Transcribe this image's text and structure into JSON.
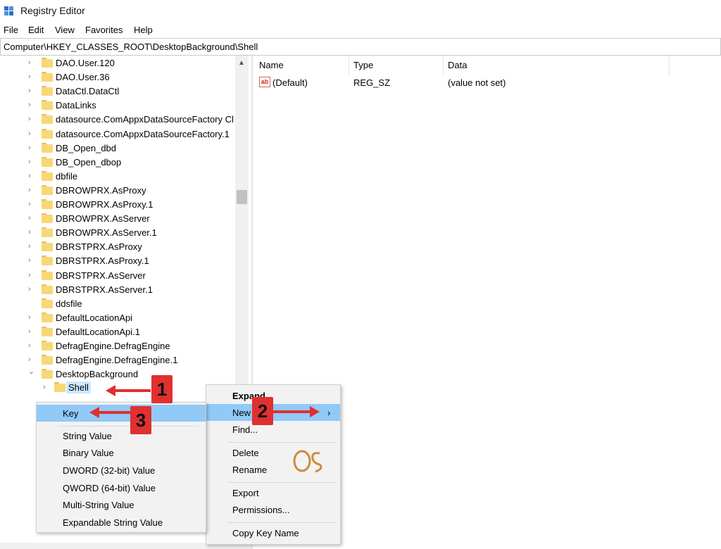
{
  "window": {
    "title": "Registry Editor"
  },
  "menubar": [
    "File",
    "Edit",
    "View",
    "Favorites",
    "Help"
  ],
  "address": "Computer\\HKEY_CLASSES_ROOT\\DesktopBackground\\Shell",
  "tree": {
    "items": [
      {
        "label": "DAO.User.120",
        "expander": "collapsed"
      },
      {
        "label": "DAO.User.36",
        "expander": "collapsed"
      },
      {
        "label": "DataCtl.DataCtl",
        "expander": "collapsed"
      },
      {
        "label": "DataLinks",
        "expander": "collapsed"
      },
      {
        "label": "datasource.ComAppxDataSourceFactory Cl",
        "expander": "collapsed"
      },
      {
        "label": "datasource.ComAppxDataSourceFactory.1",
        "expander": "collapsed"
      },
      {
        "label": "DB_Open_dbd",
        "expander": "collapsed"
      },
      {
        "label": "DB_Open_dbop",
        "expander": "collapsed"
      },
      {
        "label": "dbfile",
        "expander": "collapsed"
      },
      {
        "label": "DBROWPRX.AsProxy",
        "expander": "collapsed"
      },
      {
        "label": "DBROWPRX.AsProxy.1",
        "expander": "collapsed"
      },
      {
        "label": "DBROWPRX.AsServer",
        "expander": "collapsed"
      },
      {
        "label": "DBROWPRX.AsServer.1",
        "expander": "collapsed"
      },
      {
        "label": "DBRSTPRX.AsProxy",
        "expander": "collapsed"
      },
      {
        "label": "DBRSTPRX.AsProxy.1",
        "expander": "collapsed"
      },
      {
        "label": "DBRSTPRX.AsServer",
        "expander": "collapsed"
      },
      {
        "label": "DBRSTPRX.AsServer.1",
        "expander": "collapsed"
      },
      {
        "label": "ddsfile",
        "expander": "none"
      },
      {
        "label": "DefaultLocationApi",
        "expander": "collapsed"
      },
      {
        "label": "DefaultLocationApi.1",
        "expander": "collapsed"
      },
      {
        "label": "DefragEngine.DefragEngine",
        "expander": "collapsed"
      },
      {
        "label": "DefragEngine.DefragEngine.1",
        "expander": "collapsed"
      },
      {
        "label": "DesktopBackground",
        "expander": "expanded"
      }
    ],
    "selected_child": "Shell"
  },
  "values_pane": {
    "columns": [
      "Name",
      "Type",
      "Data"
    ],
    "rows": [
      {
        "name": "(Default)",
        "type": "REG_SZ",
        "data": "(value not set)",
        "icon": "string-value-icon",
        "icon_text": "ab"
      }
    ]
  },
  "context_menu": {
    "items": [
      "Expand",
      "New",
      "Find...",
      "Delete",
      "Rename",
      "Export",
      "Permissions...",
      "Copy Key Name"
    ],
    "highlighted": "New"
  },
  "new_submenu": {
    "items": [
      "Key",
      "String Value",
      "Binary Value",
      "DWORD (32-bit) Value",
      "QWORD (64-bit) Value",
      "Multi-String Value",
      "Expandable String Value"
    ],
    "highlighted": "Key"
  },
  "annotations": {
    "badges": [
      "1",
      "2",
      "3"
    ],
    "color": "#e03030"
  },
  "colors": {
    "highlight": "#91c9f7",
    "folder": "#f8d775",
    "menu_bg": "#f2f2f2"
  }
}
